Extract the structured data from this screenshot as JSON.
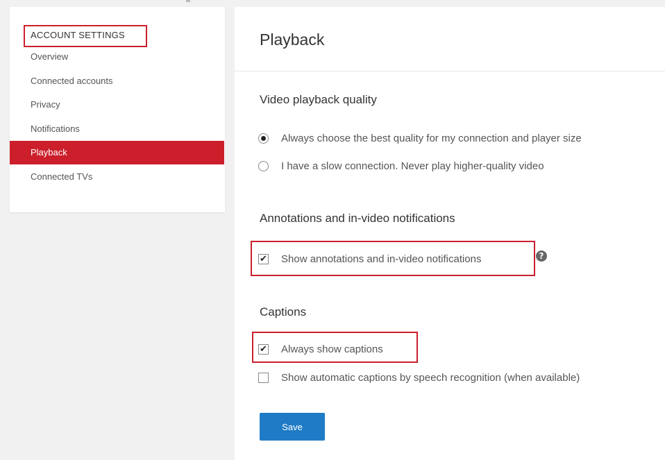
{
  "sidebar": {
    "heading": "ACCOUNT SETTINGS",
    "items": [
      {
        "label": "Overview",
        "active": false
      },
      {
        "label": "Connected accounts",
        "active": false
      },
      {
        "label": "Privacy",
        "active": false
      },
      {
        "label": "Notifications",
        "active": false
      },
      {
        "label": "Playback",
        "active": true
      },
      {
        "label": "Connected TVs",
        "active": false
      }
    ]
  },
  "main": {
    "title": "Playback",
    "quality": {
      "heading": "Video playback quality",
      "options": [
        {
          "label": "Always choose the best quality for my connection and player size",
          "selected": true
        },
        {
          "label": "I have a slow connection. Never play higher-quality video",
          "selected": false
        }
      ]
    },
    "annotations": {
      "heading": "Annotations and in-video notifications",
      "option": {
        "label": "Show annotations and in-video notifications",
        "checked": true
      },
      "help_icon": "question-mark-icon",
      "help_glyph": "?"
    },
    "captions": {
      "heading": "Captions",
      "options": [
        {
          "label": "Always show captions",
          "checked": true
        },
        {
          "label": "Show automatic captions by speech recognition (when available)",
          "checked": false
        }
      ]
    },
    "save_label": "Save"
  },
  "glyphs": {
    "check": "✔"
  },
  "colors": {
    "accent_red": "#cc1f2b",
    "save_blue": "#1f7bc6",
    "annotation_red": "#cc1f2b"
  }
}
